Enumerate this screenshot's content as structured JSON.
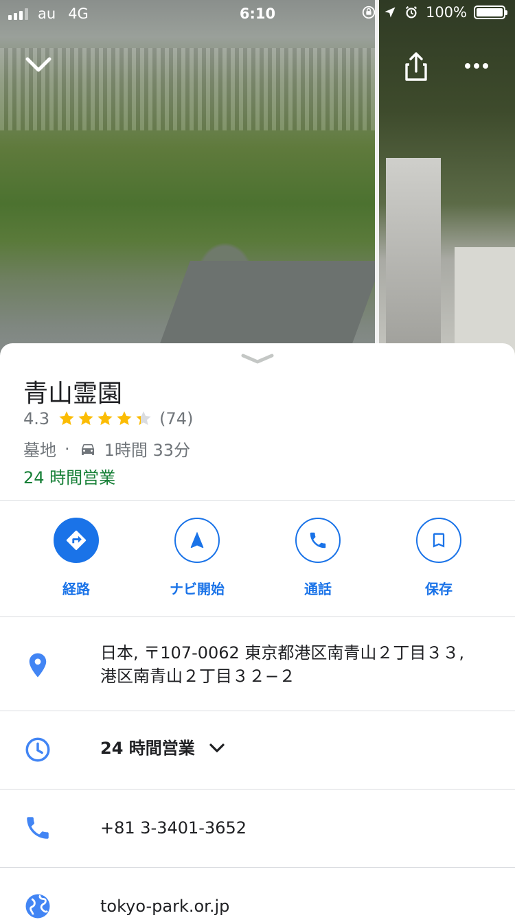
{
  "status_bar": {
    "carrier": "au",
    "network": "4G",
    "time": "6:10",
    "battery": "100%"
  },
  "place": {
    "name": "青山霊園",
    "rating": "4.3",
    "rating_value": 4.3,
    "review_count": "(74)",
    "category": "墓地",
    "separator": "·",
    "drive_time": "1時間 33分",
    "open_status": "24 時間営業"
  },
  "actions": [
    {
      "label": "経路",
      "icon": "directions-icon"
    },
    {
      "label": "ナビ開始",
      "icon": "navigation-icon"
    },
    {
      "label": "通話",
      "icon": "phone-icon"
    },
    {
      "label": "保存",
      "icon": "bookmark-icon"
    }
  ],
  "details": {
    "address_line1": "日本, 〒107-0062 東京都港区南青山２丁目３３,",
    "address_line2": "港区南青山２丁目３２−２",
    "hours": "24 時間営業",
    "phone": "+81 3-3401-3652",
    "website": "tokyo-park.or.jp"
  },
  "colors": {
    "accent": "#1a73e8",
    "open": "#188038",
    "star": "#fbbc04",
    "muted": "#70757a"
  }
}
